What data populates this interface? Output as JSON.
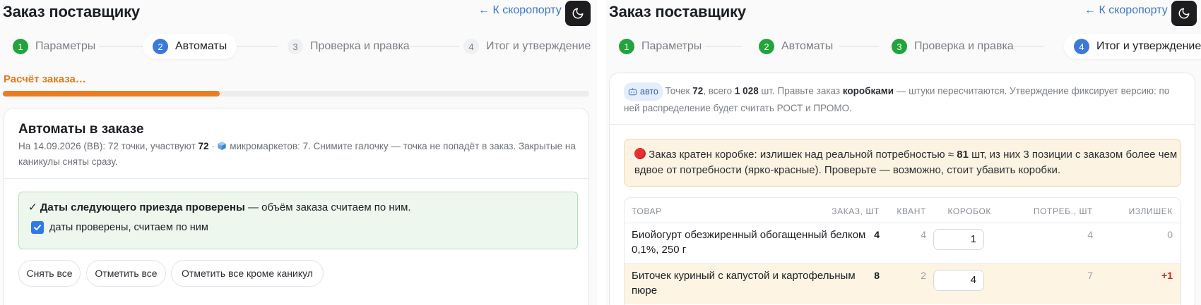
{
  "left": {
    "title": "Заказ поставщику",
    "back_link": "← К скоропорту",
    "steps": [
      {
        "num": "1",
        "label": "Параметры"
      },
      {
        "num": "2",
        "label": "Автоматы"
      },
      {
        "num": "3",
        "label": "Проверка и правка"
      },
      {
        "num": "4",
        "label": "Итог и утверждение"
      }
    ],
    "calc_label": "Расчёт заказа…",
    "progress": 0.37,
    "card": {
      "title": "Автоматы в заказе",
      "sub_1": "На 14.09.2026 (ВВ): 72 точки, участвуют ",
      "sub_count": "72",
      "sub_2": " · ",
      "sub_3": " микромаркетов: 7. Снимите галочку — точка не попадёт в заказ. Закрытые на",
      "sub_4": "каникулы сняты сразу.",
      "check_title": "Даты следующего приезда проверены",
      "check_rest": " — объём заказа считаем по ним.",
      "checkbox_label": "даты проверены, считаем по ним",
      "checkbox_checked": true
    },
    "buttons": {
      "uncheck_all": "Снять все",
      "check_all": "Отметить все",
      "check_except": "Отметить все кроме каникул"
    }
  },
  "right": {
    "title": "Заказ поставщику",
    "back_link": "← К скоропорту",
    "steps": [
      {
        "num": "1",
        "label": "Параметры"
      },
      {
        "num": "2",
        "label": "Автоматы"
      },
      {
        "num": "3",
        "label": "Проверка и правка"
      },
      {
        "num": "4",
        "label": "Итог и утверждение"
      }
    ],
    "info": {
      "badge": "авто",
      "t1": " Точек ",
      "points": "72",
      "t2": ", всего ",
      "total": "1 028",
      "t3": " шт. Правьте заказ ",
      "boxes_word": "коробками",
      "t4": " — штуки пересчитаются. Утверждение фиксирует версию: по",
      "t5": "ней распределение будет считать РОСТ и ПРОМО."
    },
    "warning": {
      "t1": " Заказ кратен коробке: излишек над реальной потребностью ≈ ",
      "excess": "81",
      "t2": " шт, из них 3 позиции с заказом более чем",
      "t3": "вдвое от потребности (ярко-красные). Проверьте — возможно, стоит убавить коробки."
    },
    "table": {
      "headers": [
        "ТОВАР",
        "ЗАКАЗ, ШТ",
        "КВАНТ",
        "КОРОБОК",
        "ПОТРЕБ., ШТ",
        "ИЗЛИШЕК"
      ],
      "rows": [
        {
          "name_1": "Биойогурт обезжиренный обогащенный белком",
          "name_2": "0,1%, 250 г",
          "order": "4",
          "quant": "4",
          "boxes": "1",
          "need": "4",
          "excess": "0"
        },
        {
          "name_1": "Биточек куриный с капустой и картофельным",
          "name_2": "пюре",
          "order": "8",
          "quant": "2",
          "boxes": "4",
          "need": "7",
          "excess": "+1"
        }
      ]
    }
  },
  "colors": {
    "done": "#22a33c",
    "current": "#3b7ad9",
    "progress": "#ea7d22",
    "excess_red": "#c8271f"
  }
}
